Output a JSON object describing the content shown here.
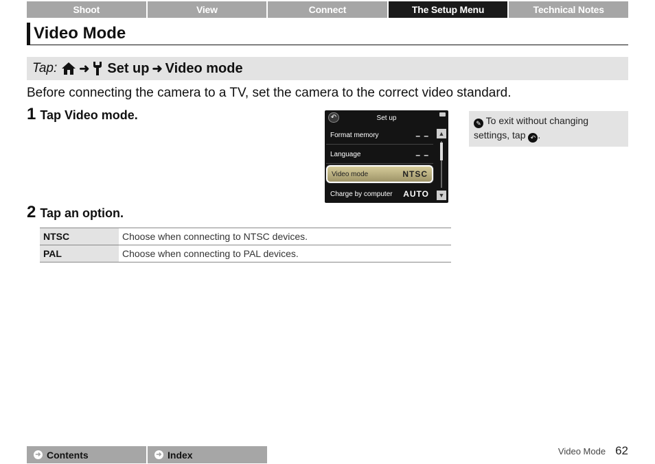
{
  "nav_tabs": [
    "Shoot",
    "View",
    "Connect",
    "The Setup Menu",
    "Technical Notes"
  ],
  "page_title": "Video Mode",
  "tap_path": {
    "label": "Tap:",
    "arrow": "➜",
    "setup": "Set up",
    "item": "Video mode",
    "icons": [
      "home-icon",
      "wrench-icon"
    ]
  },
  "intro": "Before connecting the camera to a TV, set the camera to the correct video standard.",
  "step1": {
    "num": "1",
    "prefix": "Tap ",
    "bold": "Video mode",
    "suffix": "."
  },
  "step2": {
    "num": "2",
    "text": "Tap an option."
  },
  "camera_screen": {
    "title": "Set up",
    "rows": [
      {
        "label": "Format memory",
        "value": "– –"
      },
      {
        "label": "Language",
        "value": "– –"
      },
      {
        "label": "Video mode",
        "value": "NTSC"
      },
      {
        "label": "Charge by computer",
        "value": "AUTO"
      }
    ],
    "selected_index": 2
  },
  "note": {
    "text1": "To exit without changing settings, tap ",
    "text2": "."
  },
  "options": [
    {
      "key": "NTSC",
      "desc": "Choose when connecting to NTSC devices."
    },
    {
      "key": "PAL",
      "desc": "Choose when connecting to PAL devices."
    }
  ],
  "footer": {
    "contents": "Contents",
    "index": "Index",
    "section": "Video Mode",
    "page": "62"
  }
}
